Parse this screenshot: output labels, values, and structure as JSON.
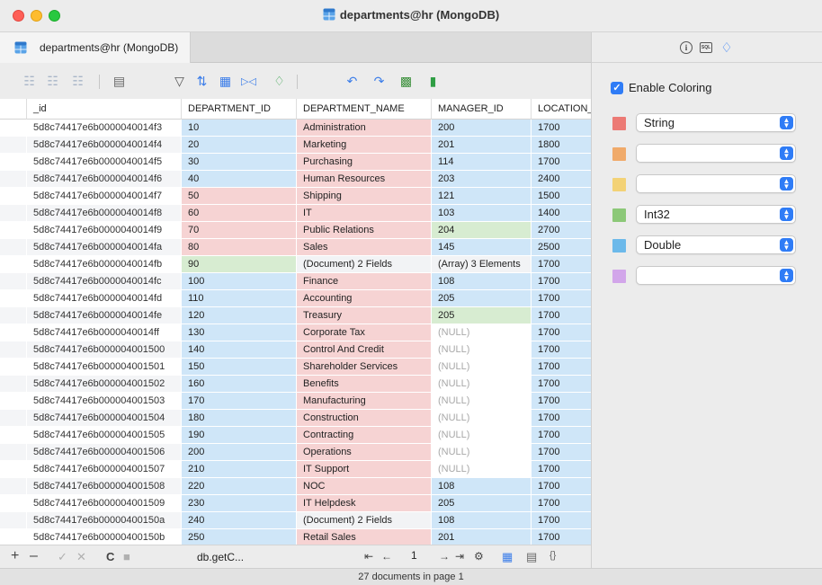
{
  "window": {
    "title": "departments@hr (MongoDB)"
  },
  "tab": {
    "label": "departments@hr (MongoDB)"
  },
  "columns": [
    "_id",
    "DEPARTMENT_ID",
    "DEPARTMENT_NAME",
    "MANAGER_ID",
    "LOCATION_"
  ],
  "rows": [
    {
      "id": "5d8c74417e6b0000040014f3",
      "dept_id": "10",
      "dept_name": "Administration",
      "manager": "200",
      "location": "1700"
    },
    {
      "id": "5d8c74417e6b0000040014f4",
      "dept_id": "20",
      "dept_name": "Marketing",
      "manager": "201",
      "location": "1800"
    },
    {
      "id": "5d8c74417e6b0000040014f5",
      "dept_id": "30",
      "dept_name": "Purchasing",
      "manager": "114",
      "location": "1700"
    },
    {
      "id": "5d8c74417e6b0000040014f6",
      "dept_id": "40",
      "dept_name": "Human Resources",
      "manager": "203",
      "location": "2400"
    },
    {
      "id": "5d8c74417e6b0000040014f7",
      "dept_id": "50",
      "dept_name": "Shipping",
      "manager": "121",
      "location": "1500"
    },
    {
      "id": "5d8c74417e6b0000040014f8",
      "dept_id": "60",
      "dept_name": "IT",
      "manager": "103",
      "location": "1400"
    },
    {
      "id": "5d8c74417e6b0000040014f9",
      "dept_id": "70",
      "dept_name": "Public Relations",
      "manager": "204",
      "location": "2700"
    },
    {
      "id": "5d8c74417e6b0000040014fa",
      "dept_id": "80",
      "dept_name": "Sales",
      "manager": "145",
      "location": "2500"
    },
    {
      "id": "5d8c74417e6b0000040014fb",
      "dept_id": "90",
      "dept_name": "(Document) 2 Fields",
      "manager": "(Array) 3 Elements",
      "location": "1700"
    },
    {
      "id": "5d8c74417e6b0000040014fc",
      "dept_id": "100",
      "dept_name": "Finance",
      "manager": "108",
      "location": "1700"
    },
    {
      "id": "5d8c74417e6b0000040014fd",
      "dept_id": "110",
      "dept_name": "Accounting",
      "manager": "205",
      "location": "1700"
    },
    {
      "id": "5d8c74417e6b0000040014fe",
      "dept_id": "120",
      "dept_name": "Treasury",
      "manager": "205",
      "location": "1700"
    },
    {
      "id": "5d8c74417e6b0000040014ff",
      "dept_id": "130",
      "dept_name": "Corporate Tax",
      "manager": "(NULL)",
      "location": "1700"
    },
    {
      "id": "5d8c74417e6b000004001500",
      "dept_id": "140",
      "dept_name": "Control And Credit",
      "manager": "(NULL)",
      "location": "1700"
    },
    {
      "id": "5d8c74417e6b000004001501",
      "dept_id": "150",
      "dept_name": "Shareholder Services",
      "manager": "(NULL)",
      "location": "1700"
    },
    {
      "id": "5d8c74417e6b000004001502",
      "dept_id": "160",
      "dept_name": "Benefits",
      "manager": "(NULL)",
      "location": "1700"
    },
    {
      "id": "5d8c74417e6b000004001503",
      "dept_id": "170",
      "dept_name": "Manufacturing",
      "manager": "(NULL)",
      "location": "1700"
    },
    {
      "id": "5d8c74417e6b000004001504",
      "dept_id": "180",
      "dept_name": "Construction",
      "manager": "(NULL)",
      "location": "1700"
    },
    {
      "id": "5d8c74417e6b000004001505",
      "dept_id": "190",
      "dept_name": "Contracting",
      "manager": "(NULL)",
      "location": "1700"
    },
    {
      "id": "5d8c74417e6b000004001506",
      "dept_id": "200",
      "dept_name": "Operations",
      "manager": "(NULL)",
      "location": "1700"
    },
    {
      "id": "5d8c74417e6b000004001507",
      "dept_id": "210",
      "dept_name": "IT Support",
      "manager": "(NULL)",
      "location": "1700"
    },
    {
      "id": "5d8c74417e6b000004001508",
      "dept_id": "220",
      "dept_name": "NOC",
      "manager": "108",
      "location": "1700"
    },
    {
      "id": "5d8c74417e6b000004001509",
      "dept_id": "230",
      "dept_name": "IT Helpdesk",
      "manager": "205",
      "location": "1700"
    },
    {
      "id": "5d8c74417e6b00000400150a",
      "dept_id": "240",
      "dept_name": "(Document) 2 Fields",
      "manager": "108",
      "location": "1700"
    },
    {
      "id": "5d8c74417e6b00000400150b",
      "dept_id": "250",
      "dept_name": "Retail Sales",
      "manager": "201",
      "location": "1700"
    }
  ],
  "coloring": {
    "enable_label": "Enable Coloring",
    "enabled": true,
    "entries": [
      {
        "color": "#ec7a75",
        "type": "String"
      },
      {
        "color": "#f0aa6a",
        "type": ""
      },
      {
        "color": "#f3d276",
        "type": ""
      },
      {
        "color": "#8cc878",
        "type": "Int32"
      },
      {
        "color": "#6cb9ea",
        "type": "Double"
      },
      {
        "color": "#d2a6ea",
        "type": ""
      }
    ]
  },
  "bottom": {
    "query": "db.getC...",
    "page": "1"
  },
  "status": "27 documents in page 1"
}
